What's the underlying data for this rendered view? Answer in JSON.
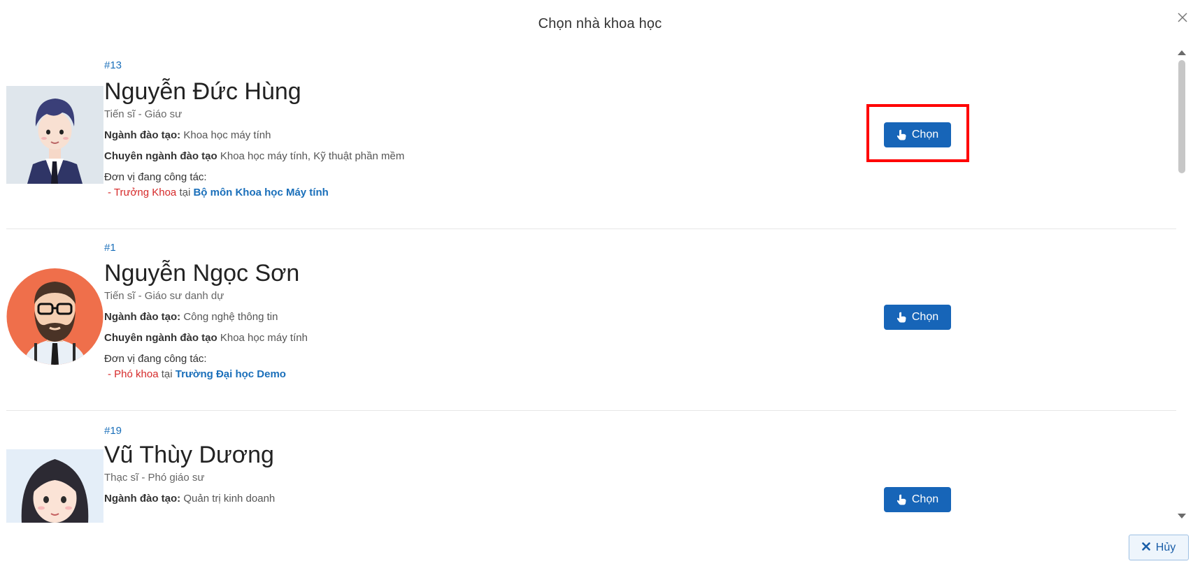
{
  "dialog": {
    "title": "Chọn nhà khoa học",
    "close_icon": "close-icon"
  },
  "labels": {
    "major": "Ngành đào tạo:",
    "specialty": "Chuyên ngành đào tạo",
    "unit": "Đơn vị đang công tác:",
    "at": "tại",
    "dash": "-"
  },
  "scientists": [
    {
      "id": "#13",
      "name": "Nguyễn Đức Hùng",
      "degree": "Tiến sĩ - Giáo sư",
      "major": "Khoa học máy tính",
      "specialty": "Khoa học máy tính, Kỹ thuật phần mềm",
      "role": "Trưởng Khoa",
      "org": "Bộ môn Khoa học Máy tính",
      "button": "Chọn",
      "avatar": "male-suit-avatar"
    },
    {
      "id": "#1",
      "name": "Nguyễn Ngọc Sơn",
      "degree": "Tiến sĩ - Giáo sư danh dự",
      "major": "Công nghệ thông tin",
      "specialty": "Khoa học máy tính",
      "role": "Phó khoa",
      "org": "Trường Đại học Demo",
      "button": "Chọn",
      "avatar": "bearded-man-avatar"
    },
    {
      "id": "#19",
      "name": "Vũ Thùy Dương",
      "degree": "Thạc sĩ - Phó giáo sư",
      "major": "Quản trị kinh doanh",
      "button": "Chọn",
      "avatar": "female-avatar"
    }
  ],
  "footer": {
    "cancel_label": "Hủy"
  },
  "colors": {
    "primary": "#1765b8",
    "highlight": "#ff0000",
    "role": "#d62a2a",
    "link": "#1a6fba"
  }
}
